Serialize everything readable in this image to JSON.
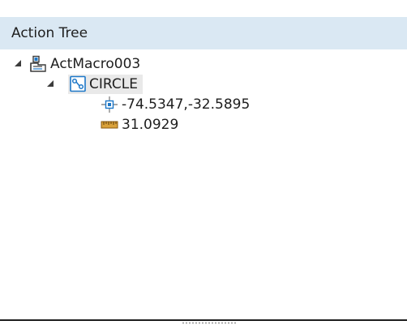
{
  "panel": {
    "title": "Action Tree"
  },
  "tree": {
    "root": {
      "label": "ActMacro003",
      "icon": "macro-icon",
      "expanded": true
    },
    "child": {
      "label": "CIRCLE",
      "icon": "circle-node-icon",
      "expanded": true,
      "selected": true
    },
    "leaves": [
      {
        "label": "-74.5347,-32.5895",
        "icon": "crosshair-point-icon"
      },
      {
        "label": "31.0929",
        "icon": "ruler-icon"
      }
    ]
  },
  "colors": {
    "header_bg": "#dae8f3",
    "selected_bg": "#e9e9e9",
    "icon_blue": "#1e78c8"
  }
}
